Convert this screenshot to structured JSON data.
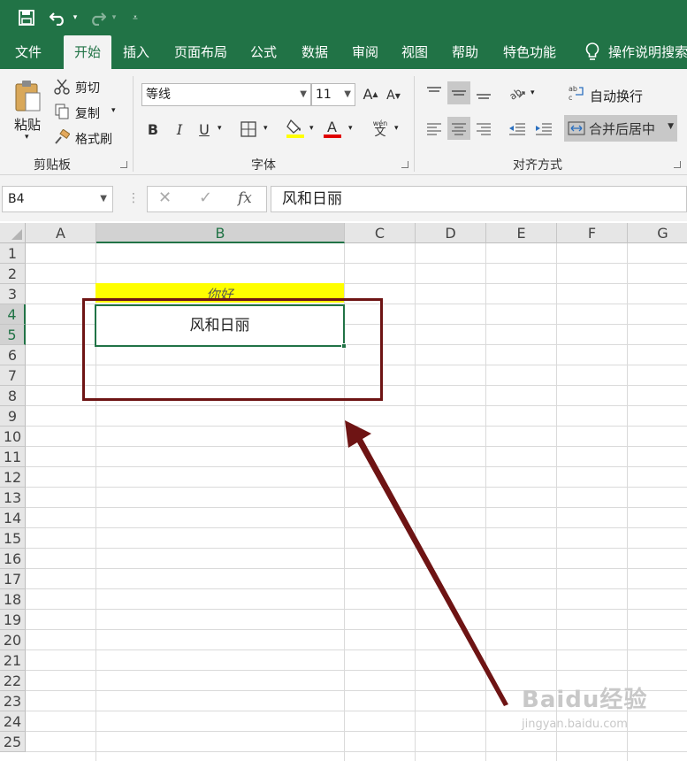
{
  "tabs": [
    "文件",
    "开始",
    "插入",
    "页面布局",
    "公式",
    "数据",
    "审阅",
    "视图",
    "帮助",
    "特色功能"
  ],
  "tell_me": "操作说明搜索",
  "ribbon": {
    "clipboard": {
      "paste": "粘贴",
      "cut": "剪切",
      "copy": "复制",
      "format_painter": "格式刷",
      "label": "剪贴板"
    },
    "font": {
      "name": "等线",
      "size": "11",
      "bold": "B",
      "italic": "I",
      "underline": "U",
      "label": "字体",
      "phonetic": "wén\n文"
    },
    "alignment": {
      "wrap": "自动换行",
      "merge": "合并后居中",
      "label": "对齐方式"
    }
  },
  "formula_bar": {
    "name_box": "B4",
    "fx": "fx",
    "content": "风和日丽"
  },
  "columns": [
    "A",
    "B",
    "C",
    "D",
    "E",
    "F",
    "G"
  ],
  "rows": [
    "1",
    "2",
    "3",
    "4",
    "5",
    "6",
    "7",
    "8",
    "9",
    "10",
    "11",
    "12",
    "13",
    "14",
    "15",
    "16",
    "17",
    "18",
    "19",
    "20",
    "21",
    "22",
    "23",
    "24",
    "25"
  ],
  "cells": {
    "B3": "你好",
    "B4": "风和日丽"
  },
  "selected_cell": "B4",
  "colors": {
    "excel_green": "#217346",
    "highlight_yellow": "#ffff00",
    "annotation": "#6e1414"
  },
  "watermark": {
    "line1": "Baidu经验",
    "line2": "jingyan.baidu.com"
  }
}
